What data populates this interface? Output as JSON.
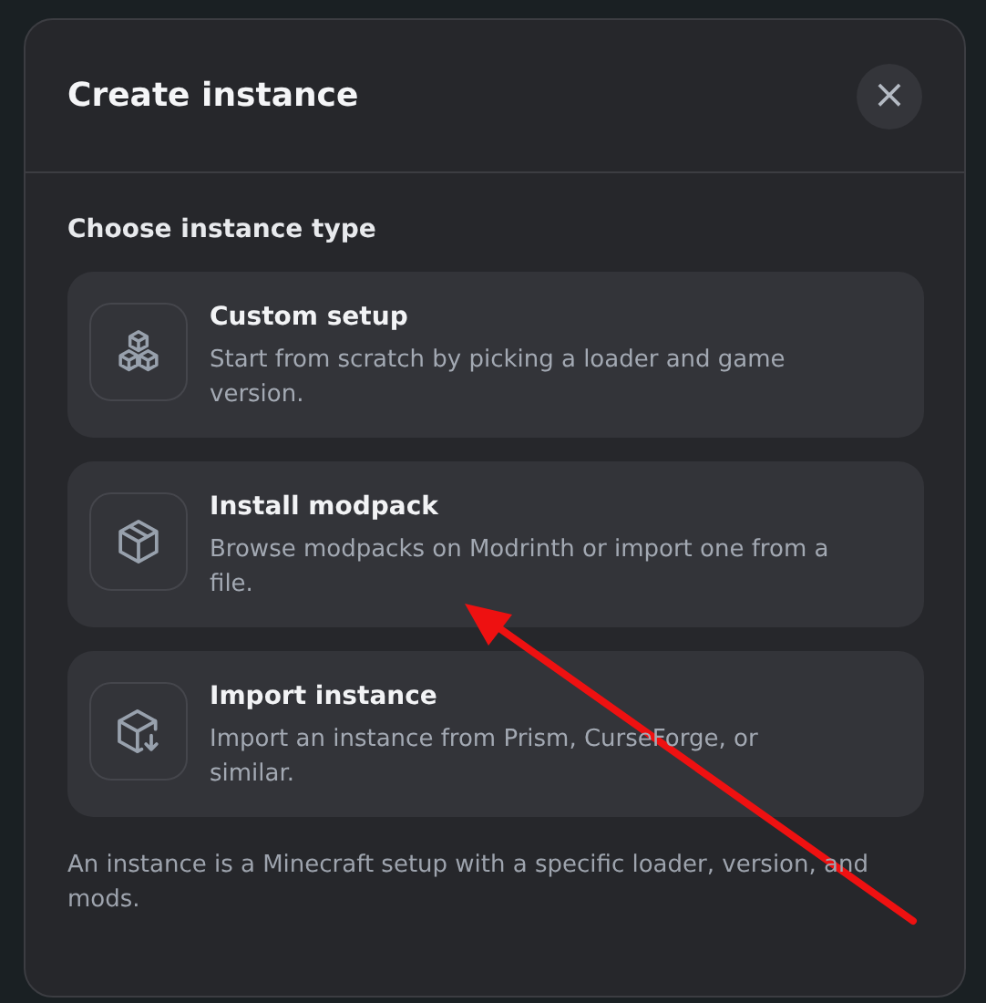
{
  "dialog": {
    "title": "Create instance",
    "close_label": "×"
  },
  "section_title": "Choose instance type",
  "options": [
    {
      "kind": "custom",
      "title": "Custom setup",
      "description": "Start from scratch by picking a loader and game version."
    },
    {
      "kind": "modpack",
      "title": "Install modpack",
      "description": "Browse modpacks on Modrinth or import one from a file."
    },
    {
      "kind": "import",
      "title": "Import instance",
      "description": "Import an instance from Prism, CurseForge, or similar."
    }
  ],
  "footnote": "An instance is a Minecraft setup with a specific loader, version, and mods."
}
